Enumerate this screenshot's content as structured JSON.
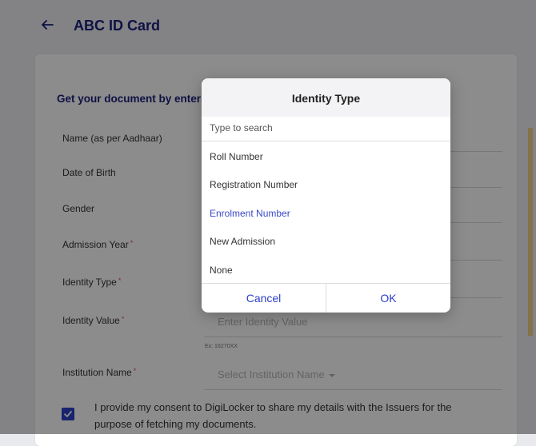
{
  "header": {
    "title": "ABC ID Card"
  },
  "form": {
    "intro": "Get your document by entering",
    "fields": {
      "name": "Name (as per Aadhaar)",
      "dob": "Date of Birth",
      "gender": "Gender",
      "admission_year": "Admission Year",
      "identity_type": "Identity Type",
      "identity_value": "Identity Value",
      "institution_name": "Institution Name"
    },
    "required_mark": "*",
    "identity_value_placeholder": "Enter Identity Value",
    "identity_value_hint": "Ex: 16270XX",
    "institution_placeholder": "Select Institution Name",
    "consent_text": "I provide my consent to DigiLocker to share my details with the Issuers for the purpose of fetching my documents.",
    "consent_checked": true
  },
  "modal": {
    "title": "Identity Type",
    "search_placeholder": "Type to search",
    "options": [
      "Roll Number",
      "Registration Number",
      "Enrolment Number",
      "New Admission",
      "None"
    ],
    "selected_option": "Enrolment Number",
    "cancel_label": "Cancel",
    "ok_label": "OK"
  },
  "colors": {
    "accent": "#2c3ec9",
    "title_blue": "#1b1f7a",
    "required_red": "#e5534b"
  }
}
